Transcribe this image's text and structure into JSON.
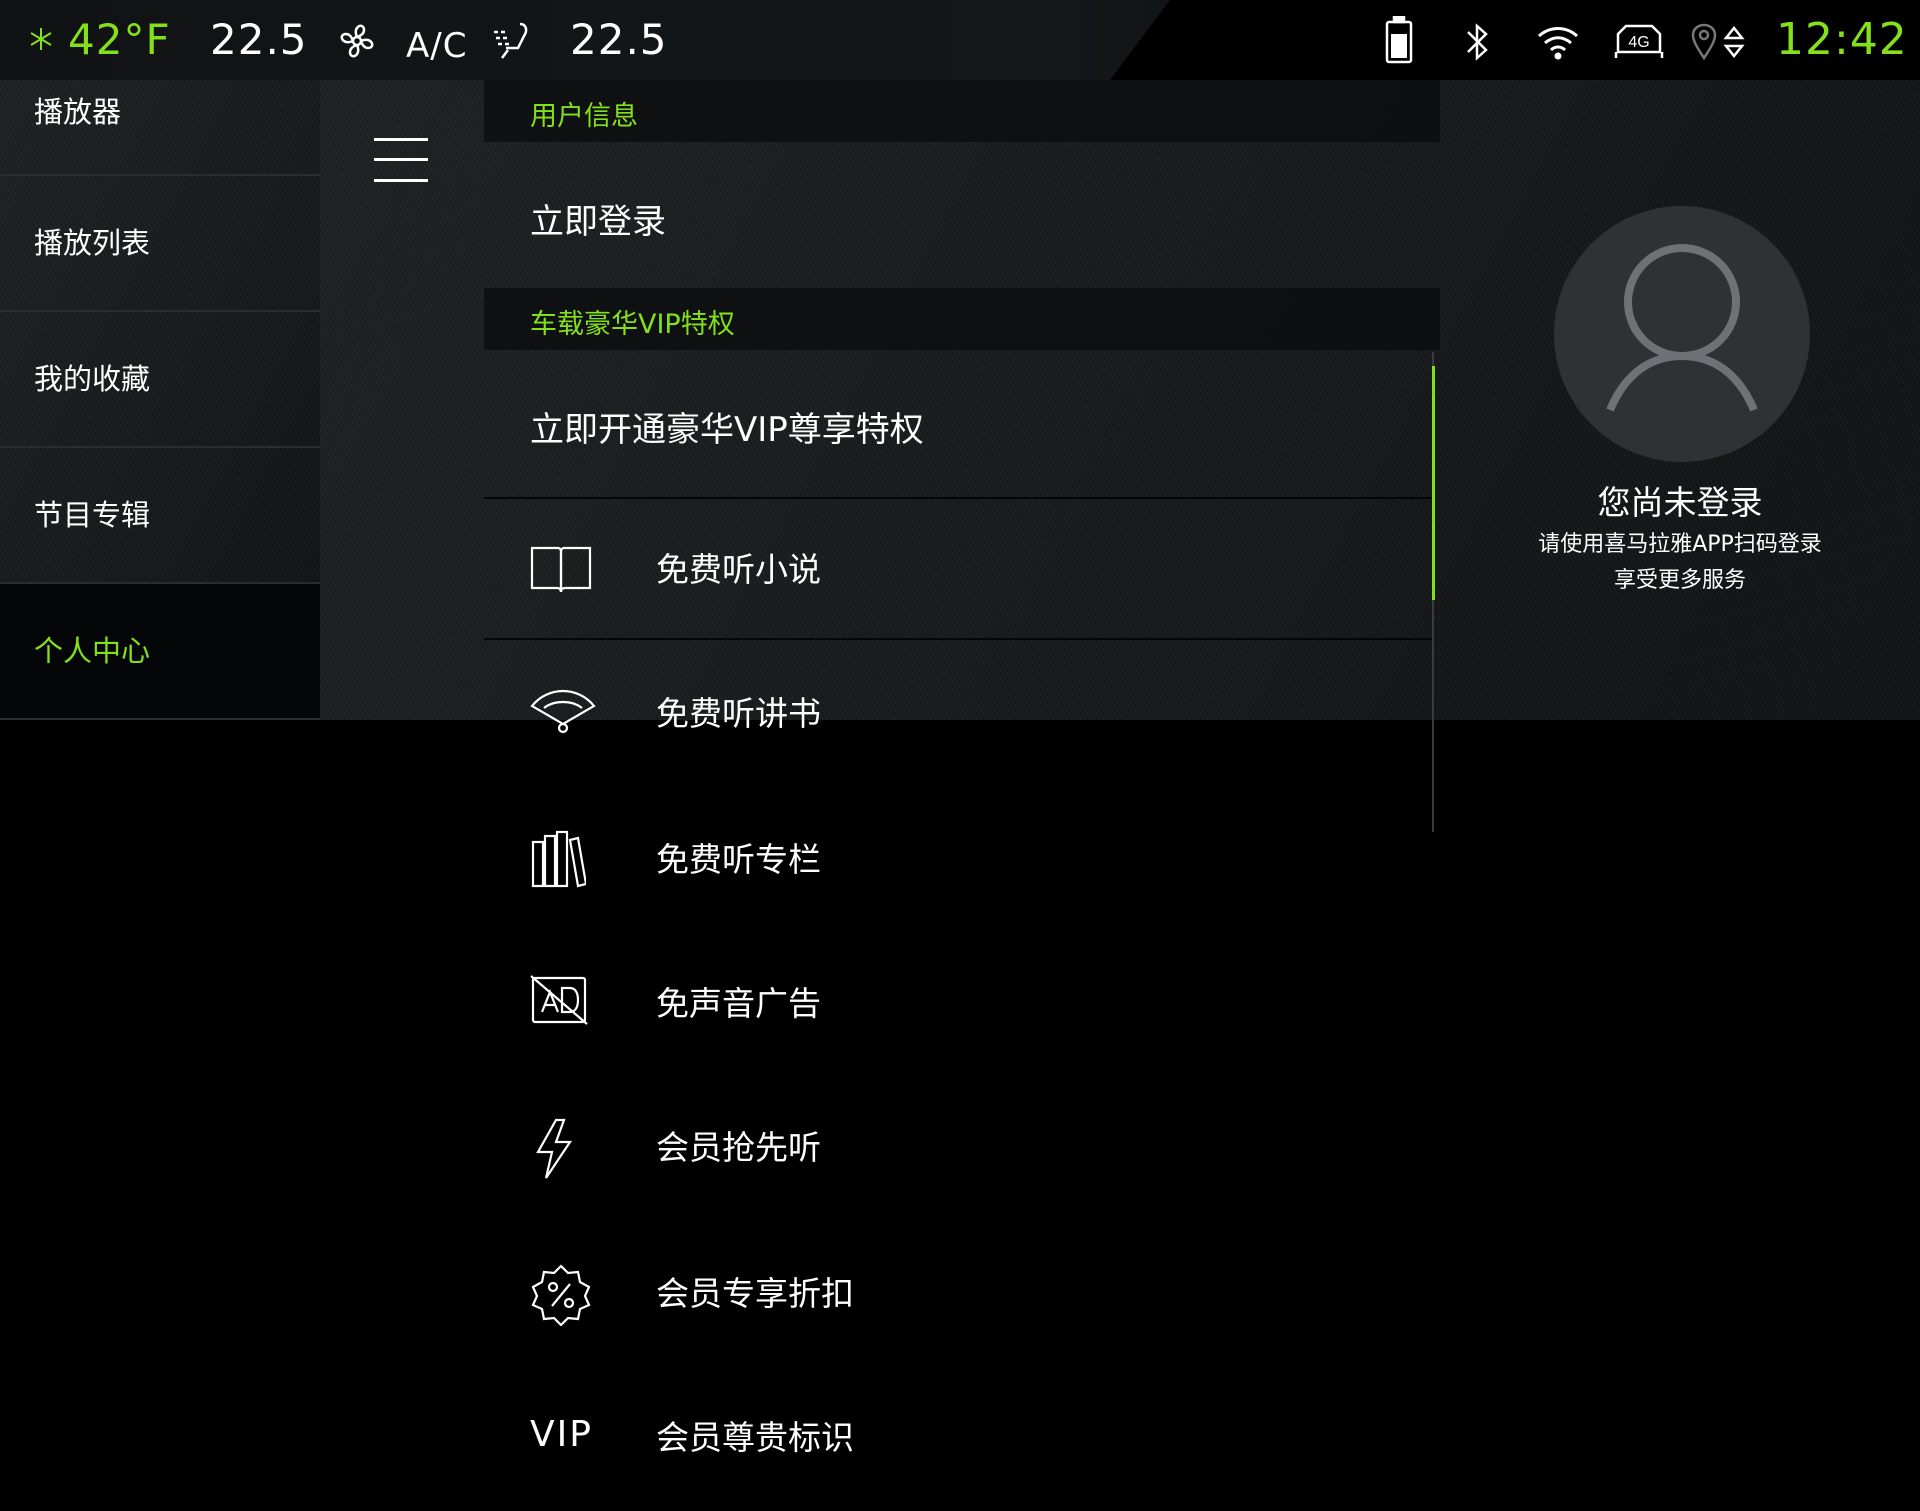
{
  "status_bar": {
    "outside_temp": "42°F",
    "driver_temp": "22.5",
    "ac_label": "A/C",
    "passenger_temp": "22.5",
    "network": "4G",
    "time": "12:42"
  },
  "sidebar": {
    "items": [
      {
        "label": "播放器"
      },
      {
        "label": "播放列表"
      },
      {
        "label": "我的收藏"
      },
      {
        "label": "节目专辑"
      },
      {
        "label": "个人中心"
      }
    ]
  },
  "main": {
    "user_section_title": "用户信息",
    "login_now": "立即登录",
    "vip_section_title": "车载豪华VIP特权",
    "vip_open": "立即开通豪华VIP尊享特权",
    "benefits": [
      {
        "label": "免费听小说",
        "icon": "book-icon"
      },
      {
        "label": "免费听讲书",
        "icon": "fan-icon"
      },
      {
        "label": "免费听专栏",
        "icon": "bookshelf-icon"
      },
      {
        "label": "免声音广告",
        "icon": "no-ad-icon"
      },
      {
        "label": "会员抢先听",
        "icon": "lightning-icon"
      },
      {
        "label": "会员专享折扣",
        "icon": "discount-badge-icon"
      },
      {
        "label": "会员尊贵标识",
        "icon": "vip-text-icon"
      }
    ],
    "vip_icon_text": "VIP"
  },
  "profile": {
    "not_logged_in": "您尚未登录",
    "scan_hint": "请使用喜马拉雅APP扫码登录",
    "more_services": "享受更多服务"
  },
  "colors": {
    "accent": "#84e01b",
    "background": "#000000",
    "panel": "#17191b"
  }
}
